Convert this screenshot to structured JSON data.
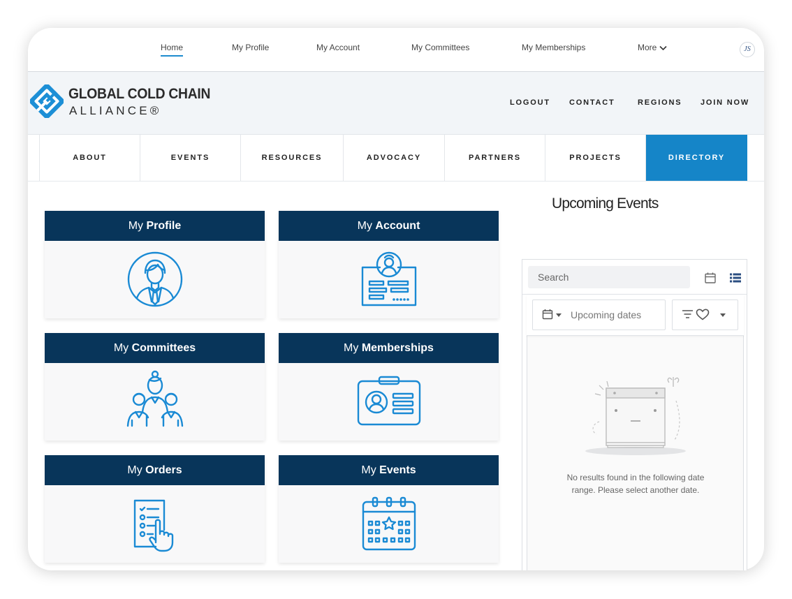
{
  "top_nav": {
    "items": [
      "Home",
      "My Profile",
      "My Account",
      "My Committees",
      "My Memberships",
      "More"
    ],
    "avatar_initials": "JS"
  },
  "brand": {
    "line1": "GLOBAL COLD CHAIN",
    "line2": "ALLIANCE®"
  },
  "header_links": [
    "LOGOUT",
    "CONTACT",
    "REGIONS",
    "JOIN NOW"
  ],
  "main_nav": {
    "tabs": [
      "ABOUT",
      "EVENTS",
      "RESOURCES",
      "ADVOCACY",
      "PARTNERS",
      "PROJECTS",
      "DIRECTORY"
    ],
    "active": "DIRECTORY"
  },
  "cards": [
    {
      "prefix": "My",
      "label": "Profile",
      "icon": "profile-person-icon"
    },
    {
      "prefix": "My",
      "label": "Account",
      "icon": "account-id-card-icon"
    },
    {
      "prefix": "My",
      "label": "Committees",
      "icon": "committee-group-icon"
    },
    {
      "prefix": "My",
      "label": "Memberships",
      "icon": "membership-badge-icon"
    },
    {
      "prefix": "My",
      "label": "Orders",
      "icon": "orders-checklist-icon"
    },
    {
      "prefix": "My",
      "label": "Events",
      "icon": "events-calendar-icon"
    }
  ],
  "events": {
    "title": "Upcoming Events",
    "search_placeholder": "Search",
    "date_filter": "Upcoming dates",
    "empty_message": "No results found in the following date range. Please select another date."
  },
  "colors": {
    "card_header": "#08355a",
    "accent": "#1585c8",
    "icon_blue": "#1a8ad4"
  }
}
